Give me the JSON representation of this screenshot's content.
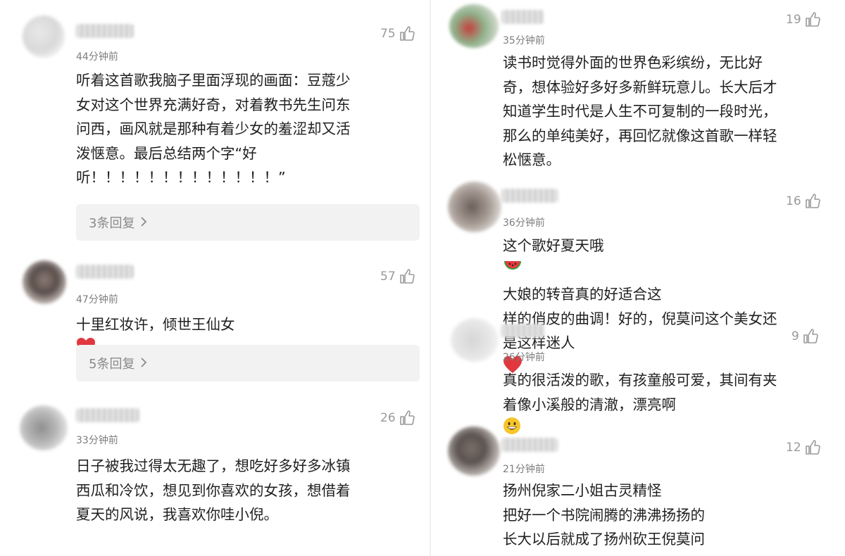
{
  "left": [
    {
      "likes": "75",
      "time": "44分钟前",
      "lines": [
        "听着这首歌我脑子里面浮现的画面：豆蔻少",
        "女对这个世界充满好奇，对着教书先生问东",
        "问西，画风就是那种有着少女的羞涩却又活",
        "泼惬意。最后总结两个字“好",
        "听！！！！！！！！！！！！！”"
      ],
      "reply": "3条回复"
    },
    {
      "likes": "57",
      "time": "47分钟前",
      "lines": [
        "十里红妆许，倾世王仙女"
      ],
      "reply": "5条回复"
    },
    {
      "likes": "26",
      "time": "33分钟前",
      "lines": [
        "日子被我过得太无趣了，想吃好多好多冰镇",
        "西瓜和冷饮，想见到你喜欢的女孩，想借着",
        "夏天的风说，我喜欢你哇小倪。"
      ]
    }
  ],
  "right": [
    {
      "likes": "19",
      "time": "35分钟前",
      "lines": [
        "读书时觉得外面的世界色彩缤纷，无比好",
        "奇，想体验好多好多新鲜玩意儿。长大后才",
        "知道学生时代是人生不可复制的一段时光，",
        "那么的单纯美好，再回忆就像这首歌一样轻",
        "松惬意。"
      ]
    },
    {
      "likes": "16",
      "time": "36分钟前",
      "lines": [
        "这个歌好夏天哦",
        "大娘的转音真的好适合这",
        "样的俏皮的曲调！好的，倪莫问这个美女还",
        "是这样迷人"
      ]
    },
    {
      "likes": "9",
      "time": "26分钟前",
      "lines": [
        "真的很活泼的歌，有孩童般可爱，其间有夹",
        "着像小溪般的清澈，漂亮啊"
      ]
    },
    {
      "likes": "12",
      "time": "21分钟前",
      "lines": [
        "扬州倪家二小姐古灵精怪",
        "把好一个书院闹腾的沸沸扬扬的",
        "长大以后就成了扬州砍王倪莫问"
      ]
    }
  ]
}
